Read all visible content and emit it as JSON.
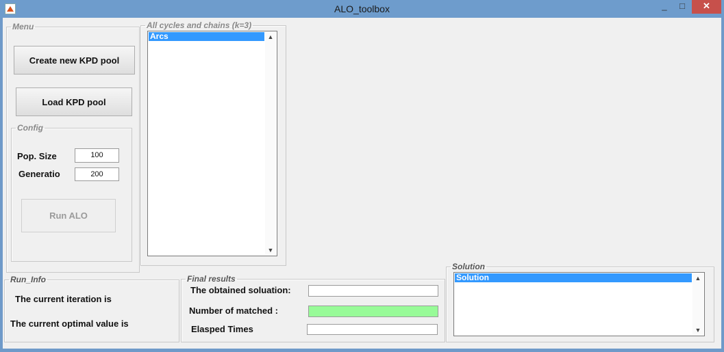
{
  "window": {
    "title": "ALO_toolbox",
    "controls": {
      "minimize": "_",
      "maximize": "□",
      "close": "✕"
    }
  },
  "menu": {
    "legend": "Menu",
    "create_button": "Create new KPD pool",
    "load_button": "Load KPD pool",
    "config": {
      "legend": "Config",
      "pop_size_label": "Pop. Size",
      "pop_size_value": "100",
      "generation_label": "Generatio",
      "generation_value": "200"
    },
    "run_button": "Run ALO"
  },
  "cycles": {
    "legend": "All cycles and chains (k=3)",
    "items": [
      "Arcs"
    ]
  },
  "run_info": {
    "legend": "Run_Info",
    "current_iteration_label": "The current iteration is",
    "current_optimal_label": "The current optimal value is"
  },
  "final_results": {
    "legend": "Final results",
    "obtained_solution_label": "The obtained soluation:",
    "obtained_solution_value": "",
    "matched_label": "Number of matched :",
    "matched_value": "",
    "elapsed_label": "Elasped Times",
    "elapsed_value": ""
  },
  "solution": {
    "legend": "Solution",
    "items": [
      "Solution"
    ]
  },
  "colors": {
    "titlebar": "#6e9ccc",
    "selection": "#3399ff",
    "matched_field": "#98fb98",
    "close_button": "#c7504b"
  }
}
